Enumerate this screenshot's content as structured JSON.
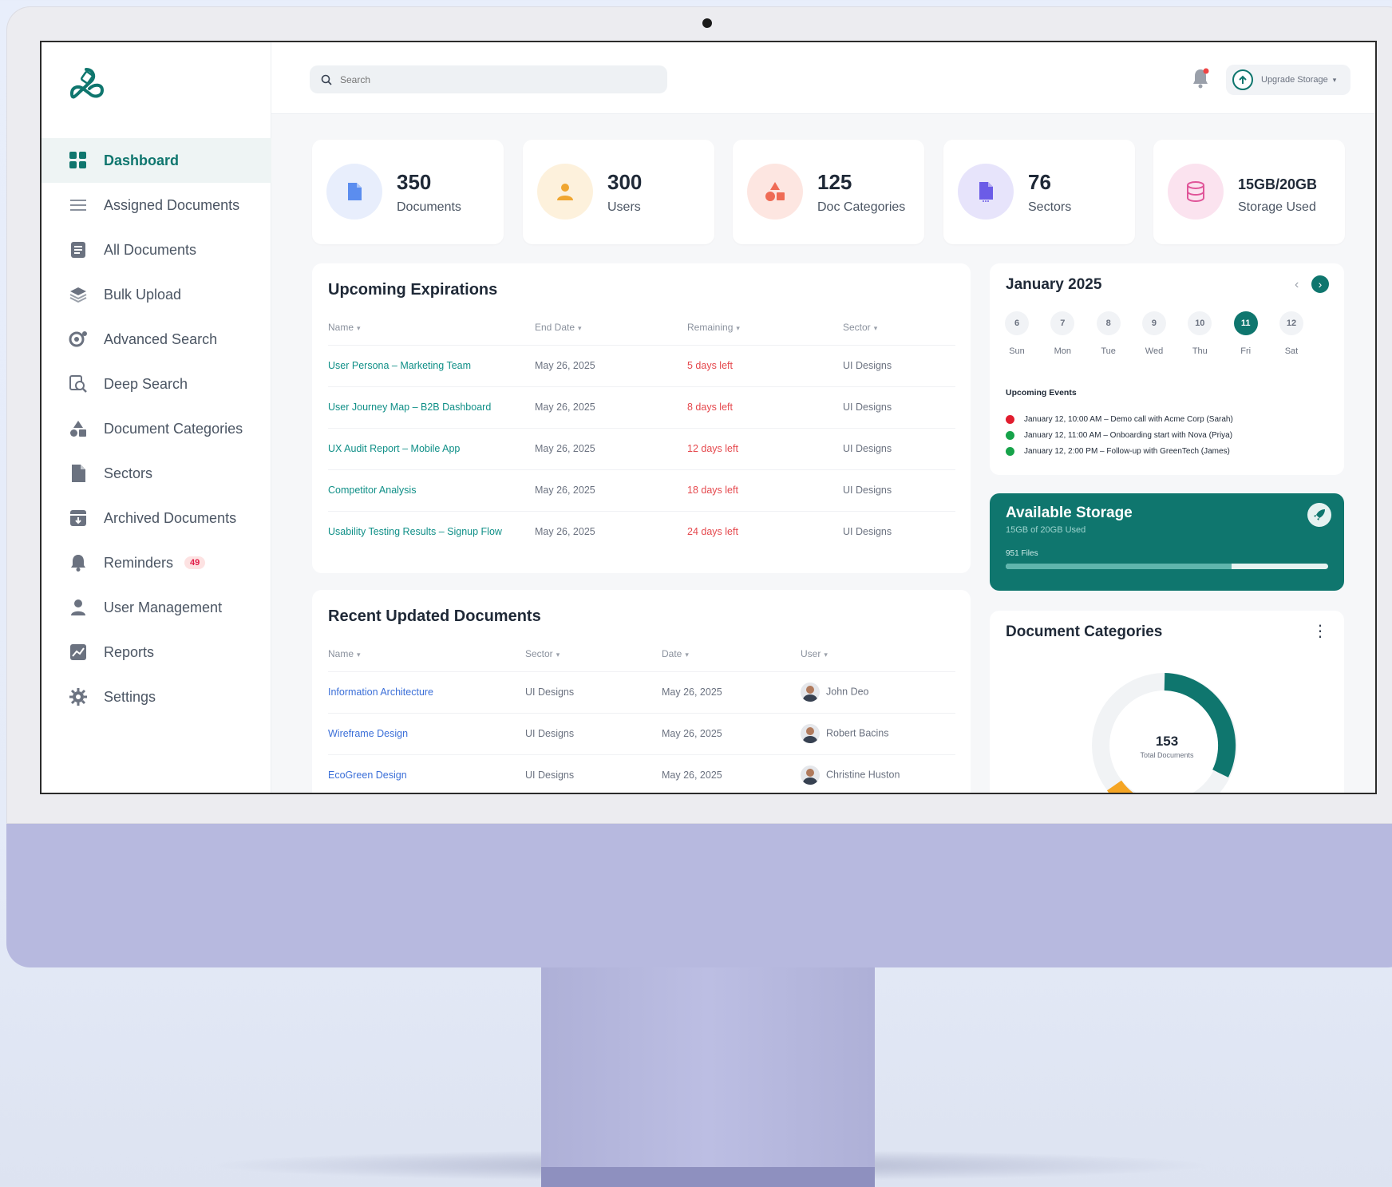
{
  "search": {
    "placeholder": "Search"
  },
  "topbar": {
    "upgrade_label": "Upgrade Storage"
  },
  "sidebar": {
    "items": [
      {
        "label": "Dashboard",
        "icon": "grid-icon",
        "active": true
      },
      {
        "label": "Assigned Documents",
        "icon": "list-icon"
      },
      {
        "label": "All Documents",
        "icon": "document-icon"
      },
      {
        "label": "Bulk Upload",
        "icon": "layers-icon"
      },
      {
        "label": "Advanced Search",
        "icon": "search-gear-icon"
      },
      {
        "label": "Deep Search",
        "icon": "search-doc-icon"
      },
      {
        "label": "Document Categories",
        "icon": "shapes-icon"
      },
      {
        "label": "Sectors",
        "icon": "file-icon"
      },
      {
        "label": "Archived Documents",
        "icon": "archive-icon"
      },
      {
        "label": "Reminders",
        "icon": "bell-icon",
        "badge": "49"
      },
      {
        "label": "User Management",
        "icon": "user-icon"
      },
      {
        "label": "Reports",
        "icon": "chart-icon"
      },
      {
        "label": "Settings",
        "icon": "gear-icon"
      }
    ]
  },
  "stats": [
    {
      "value": "350",
      "label": "Documents",
      "color": "#5b8def",
      "bg": "#e8eefc",
      "icon": "document-icon"
    },
    {
      "value": "300",
      "label": "Users",
      "color": "#f0a630",
      "bg": "#fdf1dc",
      "icon": "user-icon"
    },
    {
      "value": "125",
      "label": "Doc Categories",
      "color": "#ef6b55",
      "bg": "#fde6e1",
      "icon": "shapes-icon"
    },
    {
      "value": "76",
      "label": "Sectors",
      "color": "#6b5ce7",
      "bg": "#e7e4fb",
      "icon": "file-icon"
    },
    {
      "value": "15GB/20GB",
      "label": "Storage Used",
      "color": "#e05599",
      "bg": "#fbe3ef",
      "icon": "database-icon"
    }
  ],
  "expirations": {
    "title": "Upcoming Expirations",
    "columns": [
      "Name",
      "End Date",
      "Remaining",
      "Sector"
    ],
    "rows": [
      [
        "User Persona – Marketing Team",
        "May 26, 2025",
        "5 days left",
        "UI Designs"
      ],
      [
        "User Journey Map – B2B Dashboard",
        "May 26, 2025",
        "8 days left",
        "UI Designs"
      ],
      [
        "UX Audit Report – Mobile App",
        "May 26, 2025",
        "12 days left",
        "UI Designs"
      ],
      [
        "Competitor Analysis",
        "May 26, 2025",
        "18 days left",
        "UI Designs"
      ],
      [
        "Usability Testing Results – Signup Flow",
        "May 26, 2025",
        "24 days left",
        "UI Designs"
      ]
    ]
  },
  "recent": {
    "title": "Recent Updated Documents",
    "columns": [
      "Name",
      "Sector",
      "Date",
      "User"
    ],
    "rows": [
      [
        "Information Architecture",
        "UI Designs",
        "May 26, 2025",
        "John Deo"
      ],
      [
        "Wireframe Design",
        "UI Designs",
        "May 26, 2025",
        "Robert Bacins"
      ],
      [
        "EcoGreen Design",
        "UI Designs",
        "May 26, 2025",
        "Christine Huston"
      ]
    ]
  },
  "calendar": {
    "title": "January 2025",
    "days": [
      {
        "num": "6",
        "wd": "Sun"
      },
      {
        "num": "7",
        "wd": "Mon"
      },
      {
        "num": "8",
        "wd": "Tue"
      },
      {
        "num": "9",
        "wd": "Wed"
      },
      {
        "num": "10",
        "wd": "Thu"
      },
      {
        "num": "11",
        "wd": "Fri",
        "selected": true
      },
      {
        "num": "12",
        "wd": "Sat"
      }
    ],
    "events_title": "Upcoming Events",
    "events": [
      {
        "text": "January 12, 10:00 AM – Demo call with Acme Corp (Sarah)",
        "color": "#e11d2e"
      },
      {
        "text": "January 12, 11:00 AM – Onboarding start with Nova (Priya)",
        "color": "#16a34a"
      },
      {
        "text": "January 12, 2:00 PM – Follow-up with GreenTech (James)",
        "color": "#16a34a"
      }
    ]
  },
  "storage": {
    "title": "Available Storage",
    "subtitle": "15GB of 20GB Used",
    "files": "951 Files",
    "used_fraction": 0.7
  },
  "categories": {
    "title": "Document Categories",
    "total": "153",
    "total_label": "Total Documents"
  },
  "colors": {
    "accent": "#0f766e",
    "danger": "#e5484d"
  }
}
